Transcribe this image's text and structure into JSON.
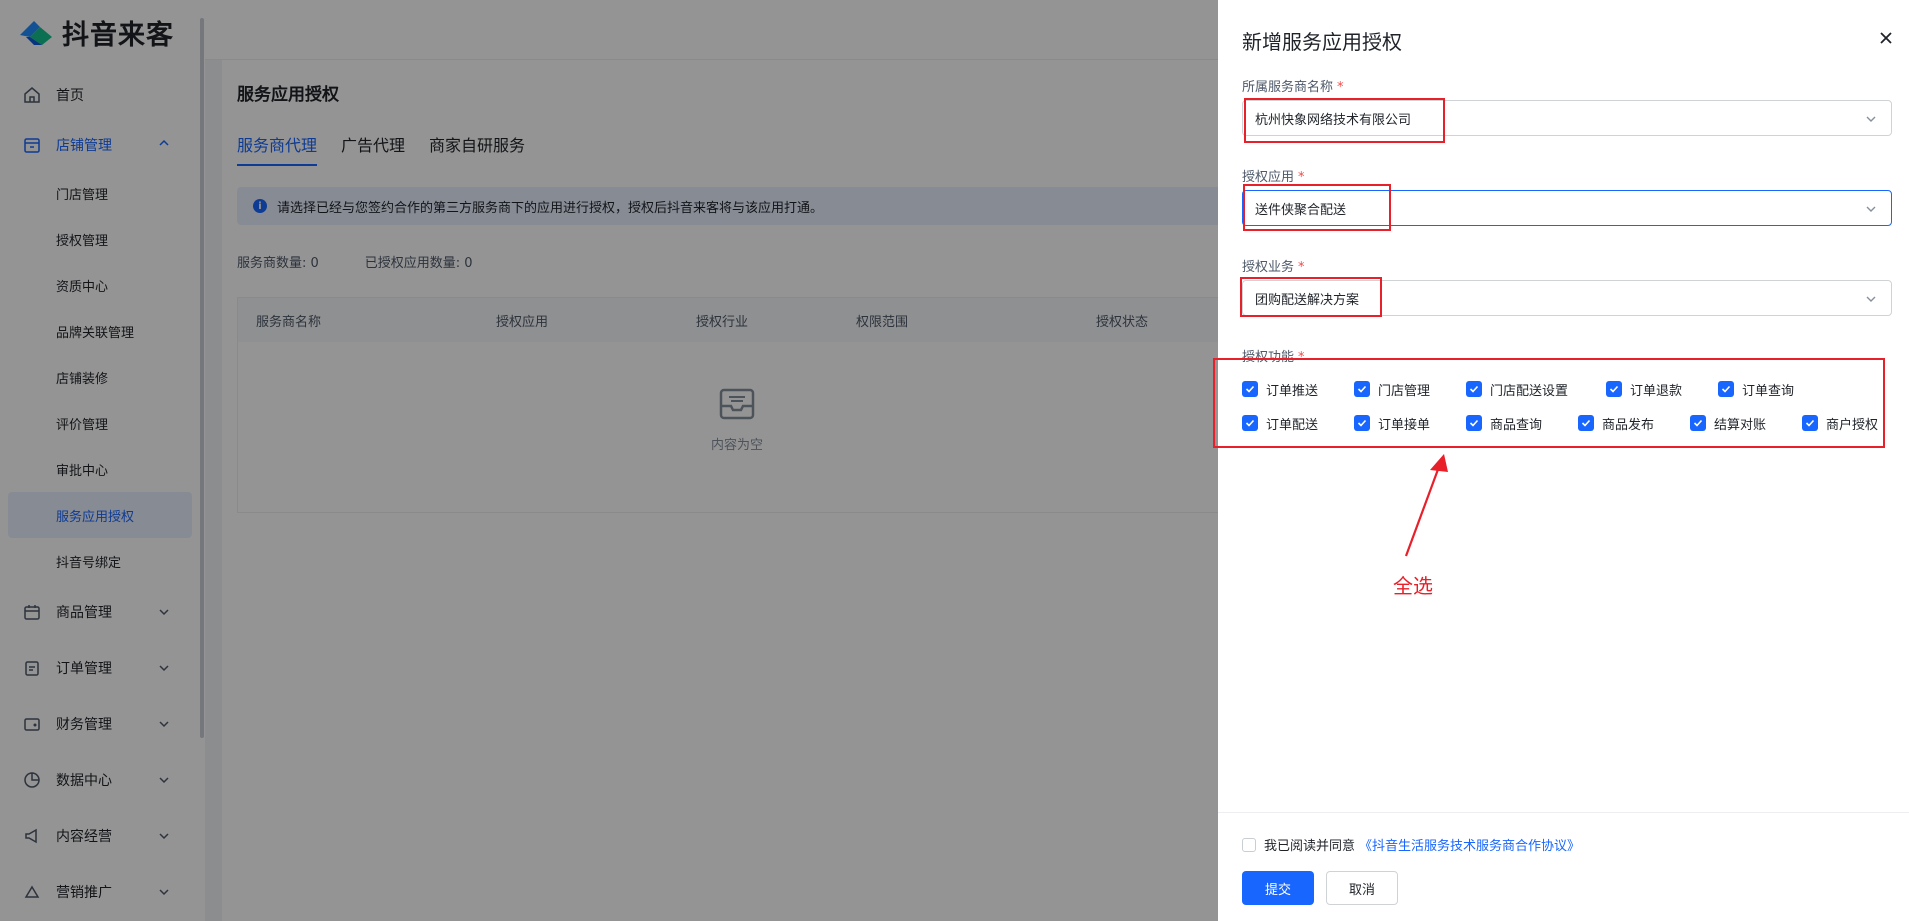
{
  "sidebar": {
    "brand": "抖音来客",
    "top_items": [
      {
        "label": "首页",
        "icon": "home-icon"
      },
      {
        "label": "店铺管理",
        "icon": "store-icon"
      }
    ],
    "sub_items": [
      {
        "label": "门店管理"
      },
      {
        "label": "授权管理"
      },
      {
        "label": "资质中心"
      },
      {
        "label": "品牌关联管理"
      },
      {
        "label": "店铺装修"
      },
      {
        "label": "评价管理"
      },
      {
        "label": "审批中心"
      },
      {
        "label": "服务应用授权",
        "active": true
      },
      {
        "label": "抖音号绑定"
      }
    ],
    "more_items": [
      {
        "label": "商品管理",
        "icon": "calendar-icon"
      },
      {
        "label": "订单管理",
        "icon": "clipboard-icon"
      },
      {
        "label": "财务管理",
        "icon": "wallet-icon"
      },
      {
        "label": "数据中心",
        "icon": "pie-chart-icon"
      },
      {
        "label": "内容经营",
        "icon": "megaphone-icon"
      },
      {
        "label": "营销推广",
        "icon": "promotion-icon"
      }
    ]
  },
  "main": {
    "title": "服务应用授权",
    "tabs": [
      "服务商代理",
      "广告代理",
      "商家自研服务"
    ],
    "notice": "请选择已经与您签约合作的第三方服务商下的应用进行授权，授权后抖音来客将与该应用打通。",
    "counts": [
      "服务商数量: 0",
      "已授权应用数量: 0"
    ],
    "table_headers": [
      "服务商名称",
      "授权应用",
      "授权行业",
      "权限范围",
      "授权状态"
    ],
    "empty_text": "内容为空"
  },
  "drawer": {
    "title": "新增服务应用授权",
    "fields": [
      {
        "label": "所属服务商名称",
        "value": "杭州快象网络技术有限公司"
      },
      {
        "label": "授权应用",
        "value": "送件侠聚合配送"
      },
      {
        "label": "授权业务",
        "value": "团购配送解决方案"
      }
    ],
    "functions_label": "授权功能",
    "function_rows": [
      [
        "订单推送",
        "门店管理",
        "门店配送设置",
        "订单退款",
        "订单查询"
      ],
      [
        "订单配送",
        "订单接单",
        "商品查询",
        "商品发布",
        "结算对账",
        "商户授权"
      ]
    ],
    "agree_text": "我已阅读并同意",
    "agree_link": "《抖音生活服务技术服务商合作协议》",
    "submit": "提交",
    "cancel": "取消"
  },
  "annotation": {
    "text": "全选",
    "color": "#e8202a"
  },
  "colors": {
    "primary": "#1966ff",
    "annotation_red": "#e8202a"
  }
}
